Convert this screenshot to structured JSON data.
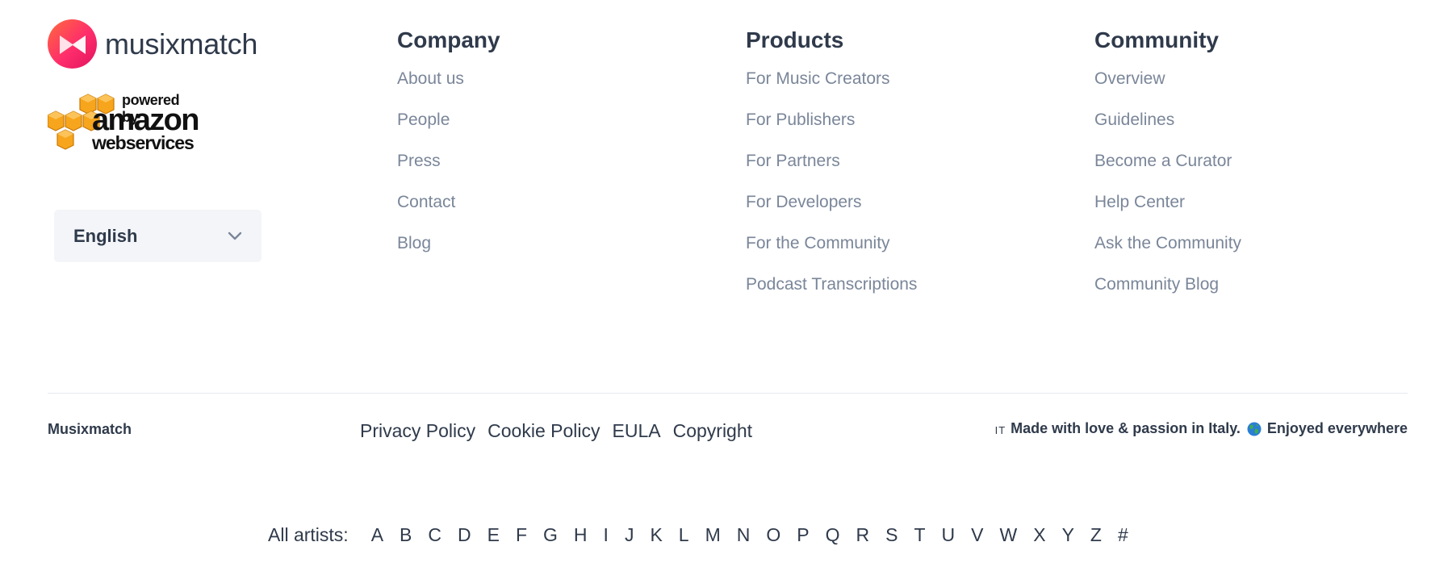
{
  "brand": {
    "name": "musixmatch",
    "logo_icon": "musixmatch-logo-icon",
    "colors": {
      "logo_gradient_start": "#ff6b3d",
      "logo_gradient_end": "#e0135f",
      "text_dark": "#2f3a4b",
      "text_muted": "#7a8699"
    }
  },
  "aws_badge": {
    "line1": "powered by",
    "line2": "amazon",
    "line3": "webservices",
    "cube_color": "#f7a51c"
  },
  "language": {
    "selected": "English"
  },
  "columns": {
    "company": {
      "title": "Company",
      "links": [
        "About us",
        "People",
        "Press",
        "Contact",
        "Blog"
      ]
    },
    "products": {
      "title": "Products",
      "links": [
        "For Music Creators",
        "For Publishers",
        "For Partners",
        "For Developers",
        "For the Community",
        "Podcast Transcriptions"
      ]
    },
    "community": {
      "title": "Community",
      "links": [
        "Overview",
        "Guidelines",
        "Become a Curator",
        "Help Center",
        "Ask the Community",
        "Community Blog"
      ]
    }
  },
  "legal": {
    "brand": "Musixmatch",
    "links": [
      "Privacy Policy",
      "Cookie Policy",
      "EULA",
      "Copyright"
    ],
    "flag_code": "IT",
    "made_with": "Made with love & passion in Italy.",
    "enjoyed": "Enjoyed everywhere"
  },
  "artists": {
    "label": "All artists:",
    "letters": [
      "A",
      "B",
      "C",
      "D",
      "E",
      "F",
      "G",
      "H",
      "I",
      "J",
      "K",
      "L",
      "M",
      "N",
      "O",
      "P",
      "Q",
      "R",
      "S",
      "T",
      "U",
      "V",
      "W",
      "X",
      "Y",
      "Z",
      "#"
    ]
  }
}
